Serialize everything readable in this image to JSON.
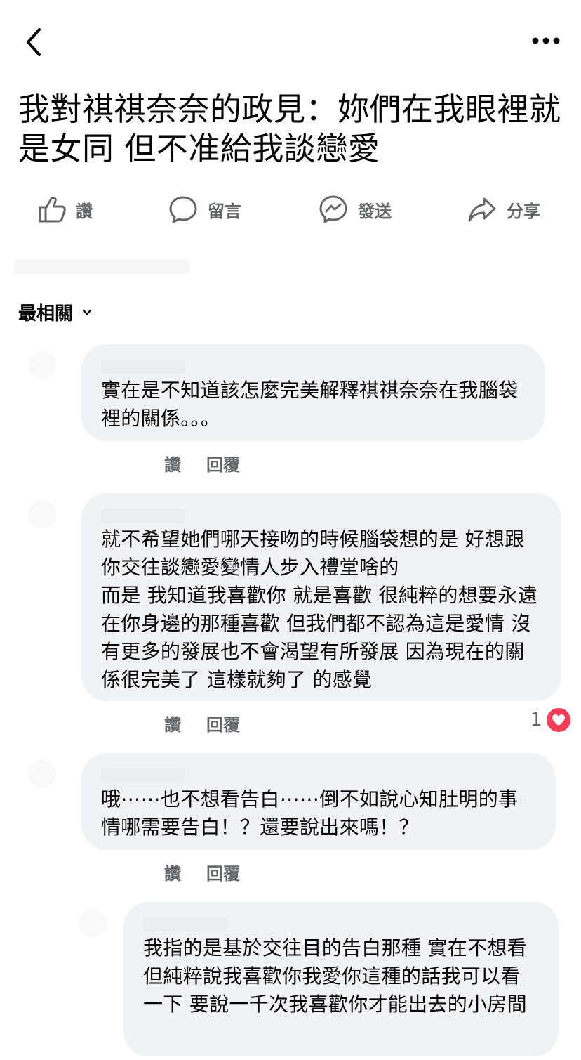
{
  "post": {
    "title": "我對祺祺奈奈的政見：妳們在我眼裡就是女同 但不准給我談戀愛"
  },
  "actions": {
    "like": "讚",
    "comment": "留言",
    "send": "發送",
    "share": "分享"
  },
  "sort": {
    "label": "最相關"
  },
  "comments": [
    {
      "text": "實在是不知道該怎麼完美解釋祺祺奈奈在我腦袋裡的關係。。。",
      "like": "讚",
      "reply": "回覆"
    },
    {
      "text": "就不希望她們哪天接吻的時候腦袋想的是 好想跟你交往談戀愛變情人步入禮堂啥的\n而是 我知道我喜歡你 就是喜歡 很純粹的想要永遠在你身邊的那種喜歡 但我們都不認為這是愛情 沒有更多的發展也不會渴望有所發展 因為現在的關係很完美了 這樣就夠了 的感覺",
      "like": "讚",
      "reply": "回覆",
      "reaction_count": "1"
    },
    {
      "text": "哦⋯⋯也不想看告白⋯⋯倒不如說心知肚明的事情哪需要告白！？還要說出來嗎！？",
      "like": "讚",
      "reply": "回覆"
    },
    {
      "text": "我指的是基於交往目的告白那種 實在不想看　　但純粹說我喜歡你我愛你這種的話我可以看一下 要說一千次我喜歡你才能出去的小房間"
    }
  ],
  "colors": {
    "bubble": "#f0f2f5",
    "meta_text": "#65676b",
    "heart": "#f33e58"
  },
  "icons": [
    "back-icon",
    "more-icon",
    "like-icon",
    "comment-icon",
    "messenger-icon",
    "share-icon",
    "chevron-down-icon",
    "heart-icon"
  ]
}
